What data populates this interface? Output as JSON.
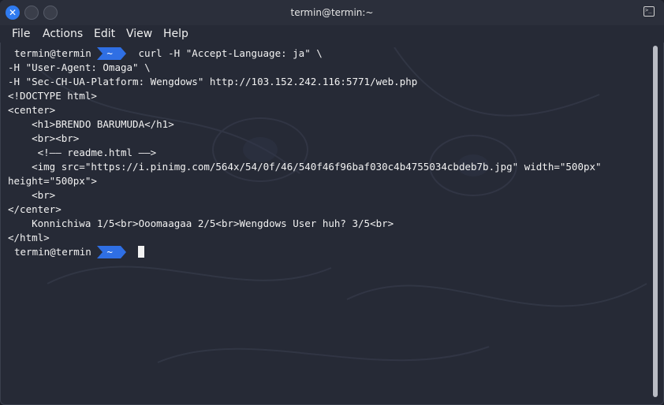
{
  "window": {
    "title": "termin@termin:~"
  },
  "menu": [
    "File",
    "Actions",
    "Edit",
    "View",
    "Help"
  ],
  "prompt": {
    "user": "termin@termin",
    "dir": "~"
  },
  "terminal": {
    "command_line1": "curl -H \"Accept-Language: ja\" \\",
    "lines": [
      "-H \"User-Agent: Omaga\" \\",
      "-H \"Sec-CH-UA-Platform: Wengdows\" http://103.152.242.116:5771/web.php",
      "<!DOCTYPE html>",
      "<center>",
      "    <h1>BRENDO BARUMUDA</h1>",
      "    <br><br>",
      "     <!—— readme.html ——>",
      "    <img src=\"https://i.pinimg.com/564x/54/0f/46/540f46f96baf030c4b4755034cbdeb7b.jpg\" width=\"500px\"",
      "height=\"500px\">",
      "    <br>",
      "</center>",
      "    Konnichiwa 1/5<br>Ooomaagaa 2/5<br>Wengdows User huh? 3/5<br>",
      "</html>"
    ]
  }
}
